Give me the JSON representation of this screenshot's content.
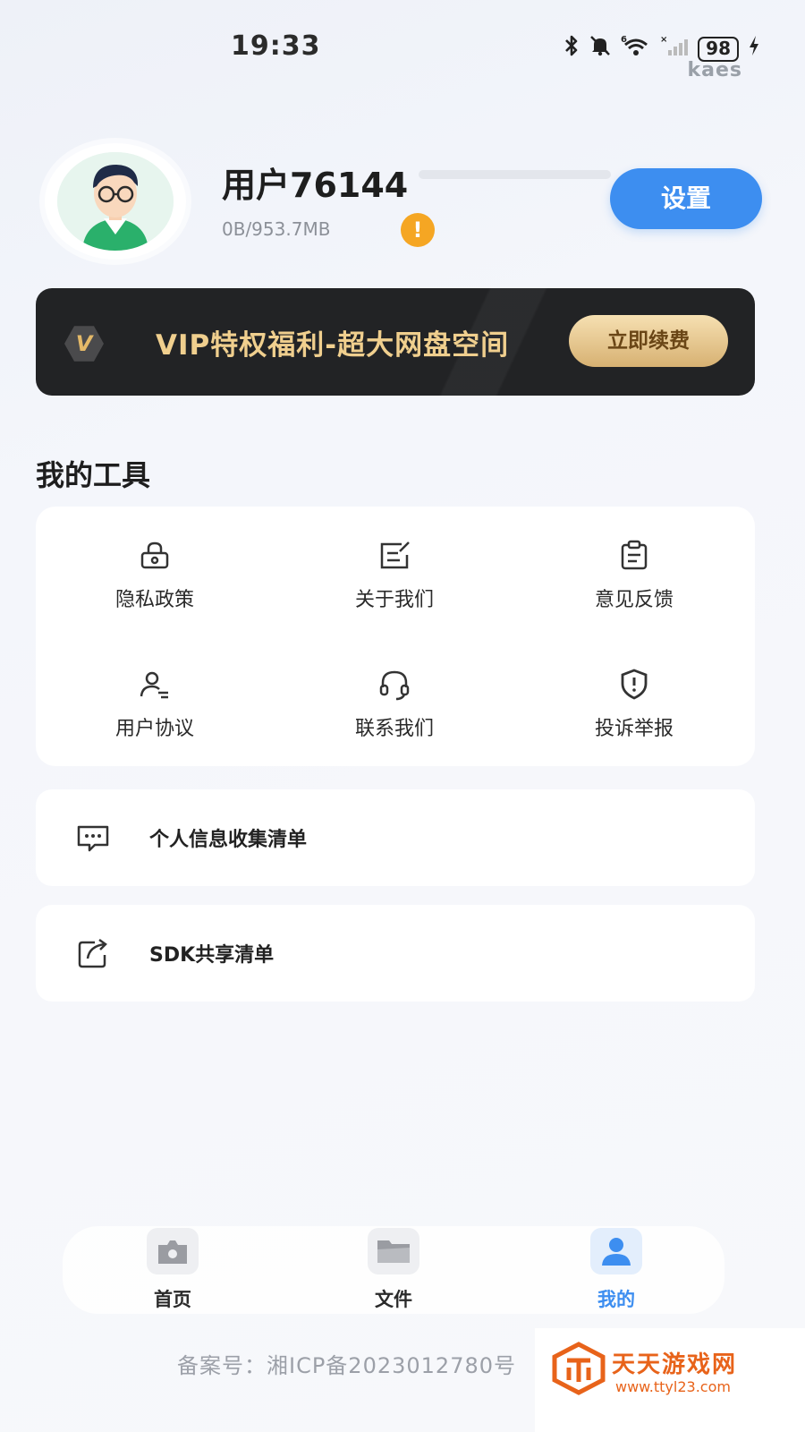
{
  "status_bar": {
    "time": "19:33",
    "battery": "98",
    "network": "6",
    "brand": "kaes"
  },
  "profile": {
    "username": "用户76144",
    "storage": "0B/953.7MB",
    "warning_mark": "!",
    "settings_label": "设置"
  },
  "vip_banner": {
    "badge": "V",
    "text": "VIP特权福利-超大网盘空间",
    "renew_label": "立即续费"
  },
  "tools": {
    "title": "我的工具",
    "items": [
      {
        "label": "隐私政策",
        "icon": "lock-icon"
      },
      {
        "label": "关于我们",
        "icon": "edit-note-icon"
      },
      {
        "label": "意见反馈",
        "icon": "clipboard-icon"
      },
      {
        "label": "用户协议",
        "icon": "user-agreement-icon"
      },
      {
        "label": "联系我们",
        "icon": "headset-icon"
      },
      {
        "label": "投诉举报",
        "icon": "shield-alert-icon"
      }
    ]
  },
  "list": [
    {
      "label": "个人信息收集清单",
      "icon": "chat-dots-icon"
    },
    {
      "label": "SDK共享清单",
      "icon": "share-icon"
    }
  ],
  "bottom_nav": [
    {
      "label": "首页",
      "icon": "home-icon",
      "active": false
    },
    {
      "label": "文件",
      "icon": "folder-icon",
      "active": false
    },
    {
      "label": "我的",
      "icon": "person-icon",
      "active": true
    }
  ],
  "footer": {
    "icp": "备案号：湘ICP备2023012780号"
  },
  "watermark": {
    "name": "天天游戏网",
    "url": "www.ttyl23.com"
  },
  "colors": {
    "accent": "#3d8ef0",
    "vip_gold": "#f0cf8e",
    "warning": "#f5a623",
    "banner_bg": "#222325"
  }
}
